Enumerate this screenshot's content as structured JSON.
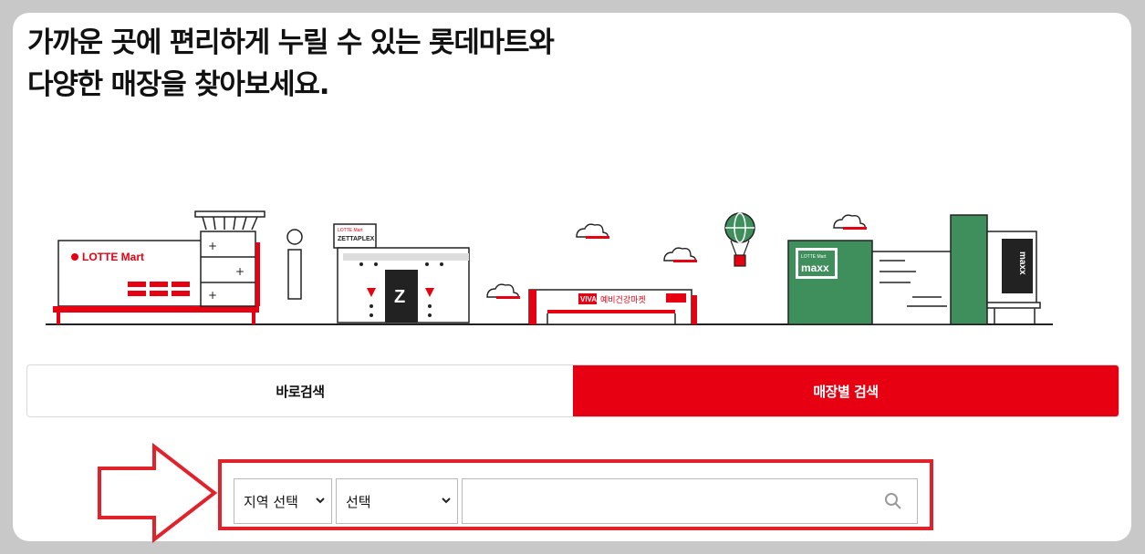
{
  "headline": {
    "line1": "가까운 곳에 편리하게 누릴 수 있는 롯데마트와",
    "line2": "다양한 매장을 찾아보세요."
  },
  "illustration": {
    "lotte_mart_sign": "LOTTE Mart",
    "zettaplex_sign": "ZETTAPLEX",
    "zettaplex_small": "LOTTE Mart",
    "zettaplex_letter": "Z",
    "viva_sign": "VIVA",
    "viva_name": "예비건강마켓",
    "maxx_small": "LOTTE Mart",
    "maxx_sign": "maxx",
    "maxx_tower": "maxx",
    "colors": {
      "red": "#e60012",
      "green": "#3f8f5c",
      "outline": "#222222"
    }
  },
  "tabs": [
    {
      "label": "바로검색",
      "active": false
    },
    {
      "label": "매장별 검색",
      "active": true
    }
  ],
  "search": {
    "region_select": "지역 선택",
    "sub_select": "선택",
    "input_value": "",
    "input_placeholder": "",
    "search_icon": "search-icon"
  }
}
